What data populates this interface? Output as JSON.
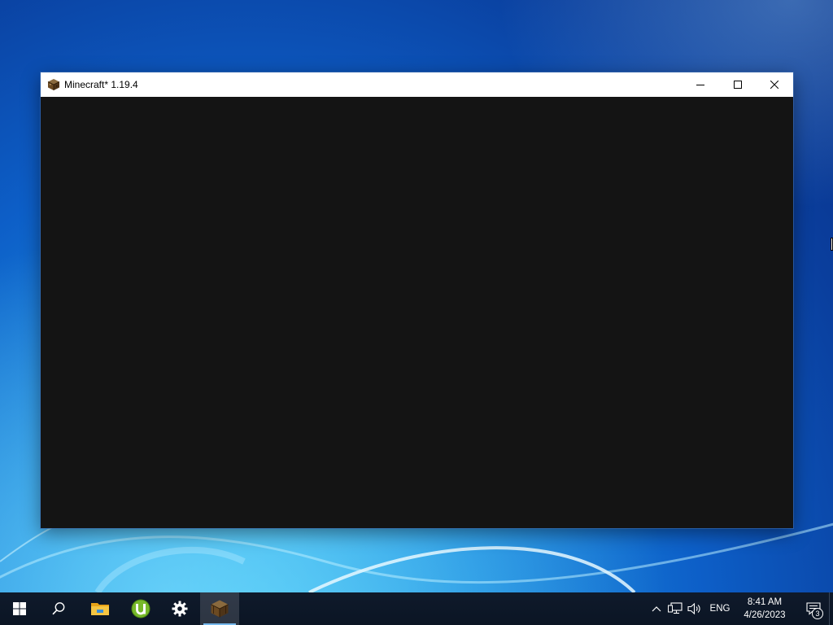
{
  "window": {
    "title": "Minecraft* 1.19.4",
    "app_icon": "minecraft-grass-block-icon",
    "buttons": [
      "minimize-icon",
      "maximize-icon",
      "close-icon"
    ]
  },
  "taskbar": {
    "pinned": [
      {
        "name": "start",
        "icon": "windows-logo-icon"
      },
      {
        "name": "search",
        "icon": "search-icon"
      },
      {
        "name": "file-explorer",
        "icon": "folder-icon"
      },
      {
        "name": "utorrent",
        "icon": "utorrent-icon"
      },
      {
        "name": "settings",
        "icon": "gear-icon"
      },
      {
        "name": "minecraft",
        "icon": "minecraft-grass-block-icon",
        "active": true
      }
    ],
    "tray": {
      "language": "ENG",
      "time": "8:41 AM",
      "date": "4/26/2023",
      "notification_count": "3",
      "icons": [
        "chevron-up-icon",
        "network-icon",
        "volume-icon",
        "notifications-icon"
      ]
    }
  },
  "colors": {
    "taskbar": "#0b1524",
    "window_client": "#141414",
    "title_bar": "#ffffff",
    "accent": "#76b9ed"
  }
}
